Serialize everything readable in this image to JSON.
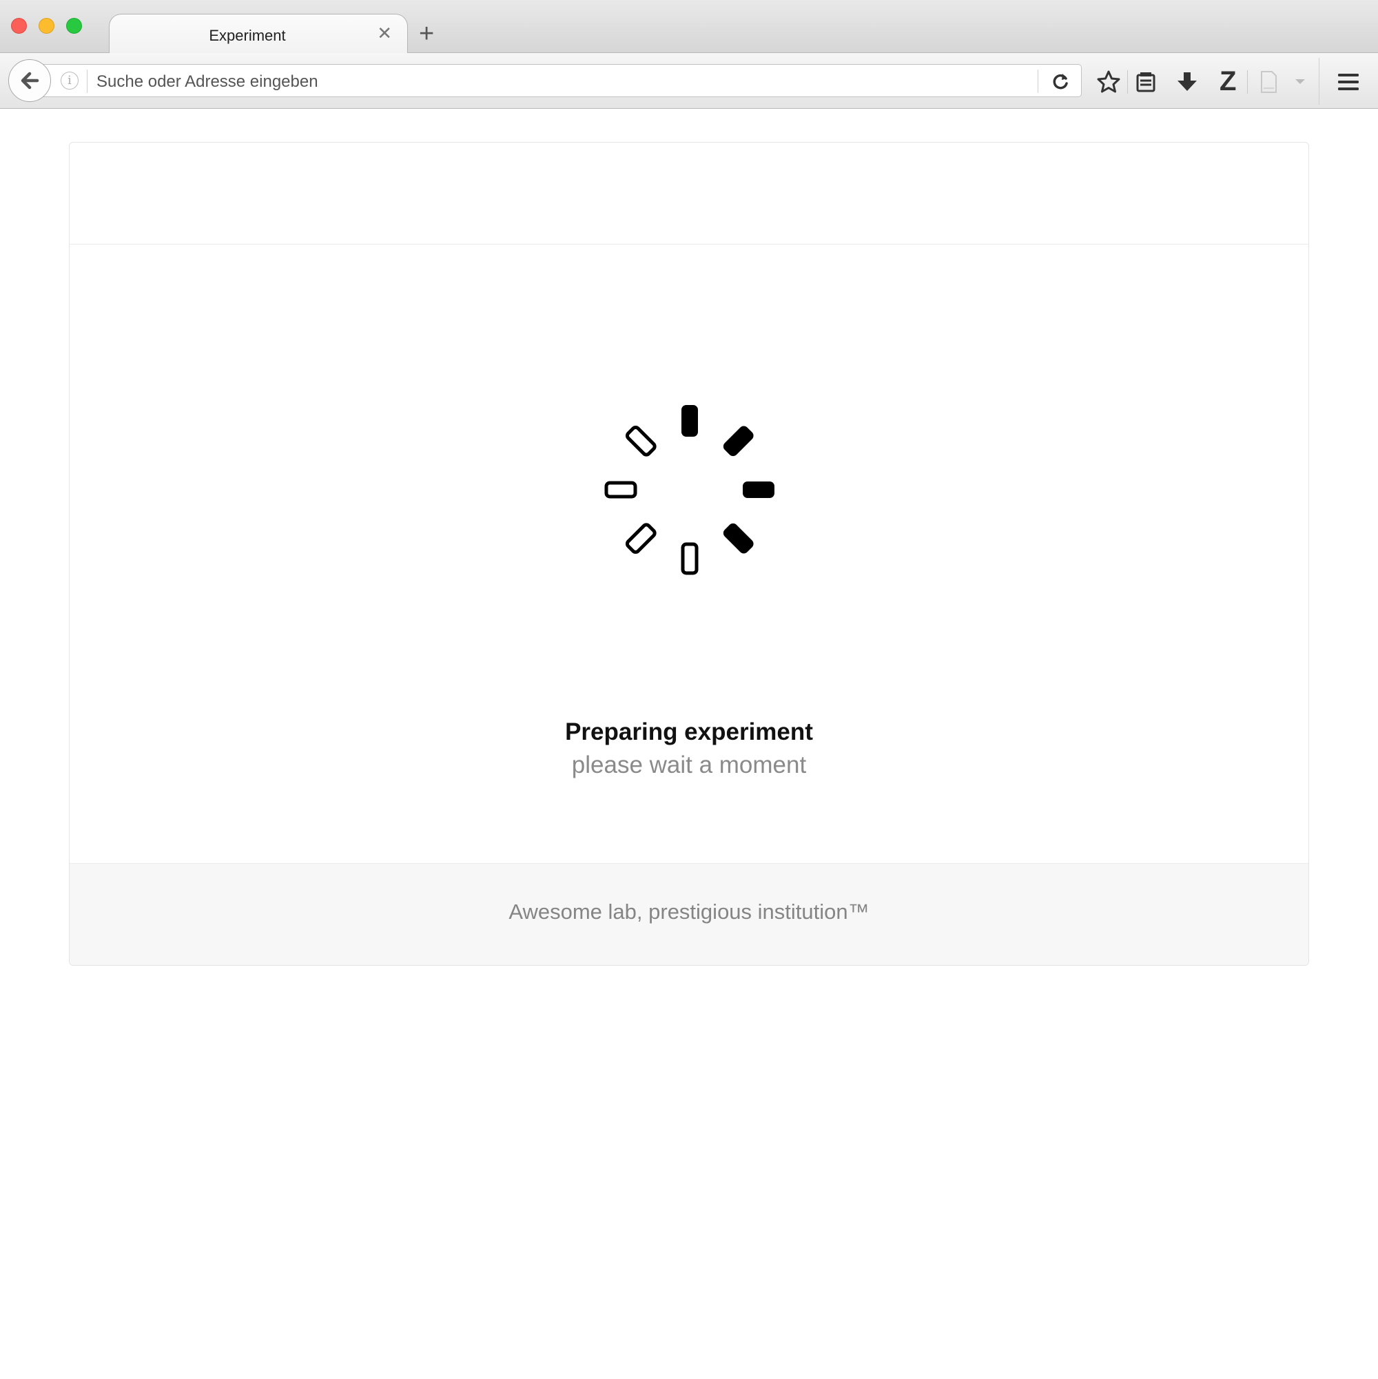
{
  "browser": {
    "tab": {
      "title": "Experiment",
      "close_glyph": "✕"
    },
    "new_tab_glyph": "+",
    "address_bar": {
      "placeholder": "Suche oder Adresse eingeben",
      "info_glyph": "i"
    },
    "toolbar_icons": [
      "back-arrow-icon",
      "info-icon",
      "reload-icon",
      "bookmark-star-icon",
      "reading-list-icon",
      "download-icon",
      "zotero-icon",
      "page-save-icon",
      "dropdown-arrow-icon",
      "hamburger-menu-icon"
    ],
    "zotero_label": "Z"
  },
  "experiment": {
    "status_title": "Preparing experiment",
    "status_subtitle": "please wait a moment",
    "footer": "Awesome lab, prestigious institution™"
  },
  "colors": {
    "close_red": "#fc5f57",
    "minimize_yellow": "#fdbc2e",
    "maximize_green": "#28c840",
    "muted_text": "#8a8a8a",
    "footer_bg": "#f7f7f7"
  }
}
